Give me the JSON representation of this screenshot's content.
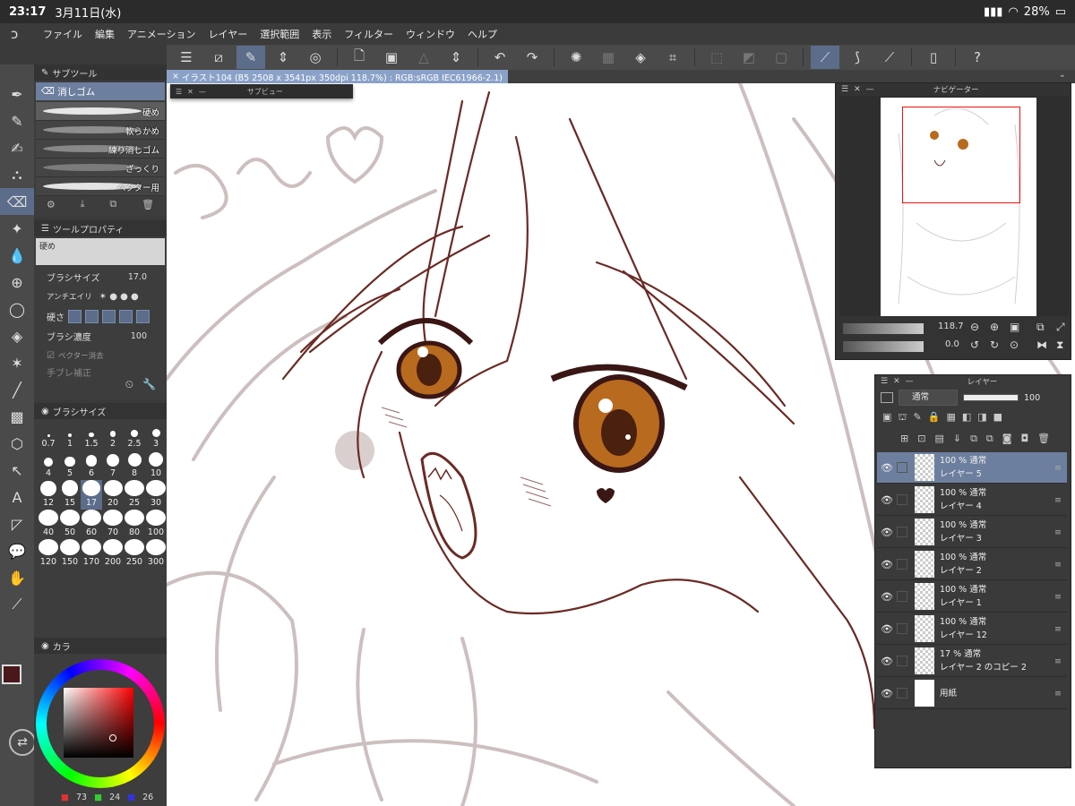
{
  "status": {
    "time": "23:17",
    "date": "3月11日(水)",
    "battery": "28%"
  },
  "menu": [
    "ファイル",
    "編集",
    "アニメーション",
    "レイヤー",
    "選択範囲",
    "表示",
    "フィルター",
    "ウィンドウ",
    "ヘルプ"
  ],
  "document_tab": "イラスト104 (B5 2508 x 3541px 350dpi 118.7%) : RGB:sRGB IEC61966-2.1)",
  "subview_title": "サブビュー",
  "subtool": {
    "title": "サブツール",
    "selected": "消しゴム",
    "brushes": [
      "硬め",
      "軟らかめ",
      "練り消しゴム",
      "ざっくり",
      "ベクター用"
    ]
  },
  "toolprop": {
    "title": "ツールプロパティ",
    "preview_label": "硬め",
    "brush_size_label": "ブラシサイズ",
    "brush_size_value": "17.0",
    "antialias_label": "アンチエイリ",
    "hardness_label": "硬さ",
    "density_label": "ブラシ濃度",
    "density_value": "100",
    "vector_erase_label": "ベクター消去",
    "cutoff_label": "手ブレ補正"
  },
  "brushsize": {
    "title": "ブラシサイズ",
    "sizes": [
      "0.7",
      "1",
      "1.5",
      "2",
      "2.5",
      "3",
      "4",
      "5",
      "6",
      "7",
      "8",
      "10",
      "12",
      "15",
      "17",
      "20",
      "25",
      "30",
      "40",
      "50",
      "60",
      "70",
      "80",
      "100",
      "120",
      "150",
      "170",
      "200",
      "250",
      "300"
    ],
    "selected": "17"
  },
  "color": {
    "tab_label": "カラ",
    "r": "73",
    "g": "24",
    "b": "26",
    "main": "#49181a",
    "sub": "#f3c5b8"
  },
  "navigator": {
    "title": "ナビゲーター",
    "zoom": "118.7",
    "rotation": "0.0"
  },
  "layers": {
    "title": "レイヤー",
    "blend_mode": "通常",
    "opacity": "100",
    "items": [
      {
        "name": "レイヤー 5",
        "info": "100 % 通常"
      },
      {
        "name": "レイヤー 4",
        "info": "100 % 通常"
      },
      {
        "name": "レイヤー 3",
        "info": "100 % 通常"
      },
      {
        "name": "レイヤー 2",
        "info": "100 % 通常"
      },
      {
        "name": "レイヤー 1",
        "info": "100 % 通常"
      },
      {
        "name": "レイヤー 12",
        "info": "100 % 通常"
      },
      {
        "name": "レイヤー 2 のコピー 2",
        "info": "17 % 通常"
      },
      {
        "name": "用紙",
        "info": ""
      }
    ]
  }
}
